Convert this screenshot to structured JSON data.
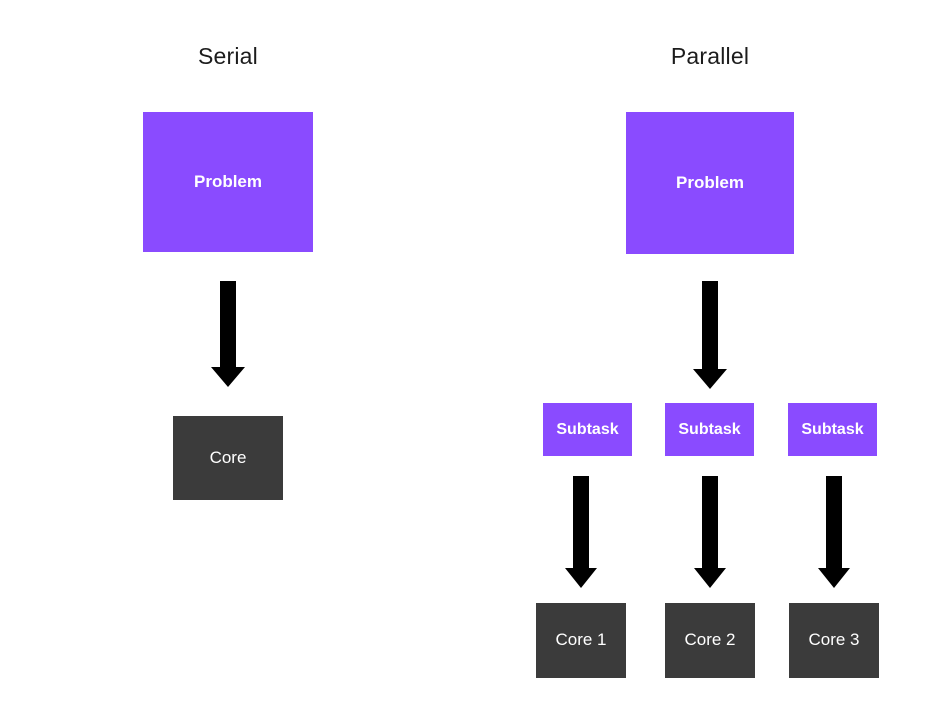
{
  "diagram": {
    "background_color": "#ffffff",
    "accent_purple": "#8a4bff",
    "core_gray": "#3b3b3b",
    "arrow_color": "#000000",
    "title_color": "#1c1c1c"
  },
  "serial": {
    "title": "Serial",
    "problem_label": "Problem",
    "core_label": "Core",
    "arrow_icon": "down-arrow-icon"
  },
  "parallel": {
    "title": "Parallel",
    "problem_label": "Problem",
    "subtasks": [
      {
        "label": "Subtask"
      },
      {
        "label": "Subtask"
      },
      {
        "label": "Subtask"
      }
    ],
    "cores": [
      {
        "label": "Core 1"
      },
      {
        "label": "Core 2"
      },
      {
        "label": "Core 3"
      }
    ],
    "arrow_icon": "down-arrow-icon"
  }
}
